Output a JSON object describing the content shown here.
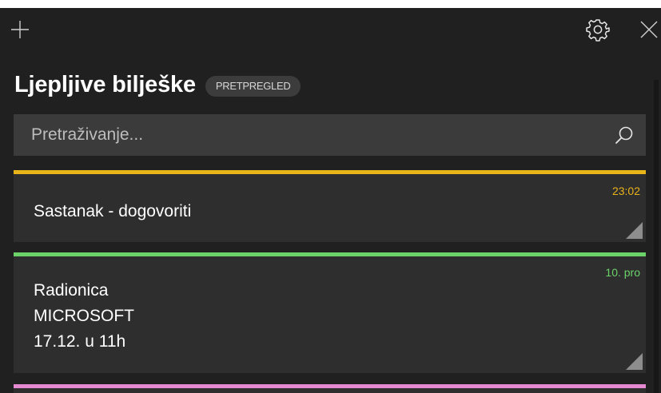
{
  "app": {
    "title": "Ljepljive bilješke",
    "badge": "PRETPREGLED"
  },
  "toolbar": {
    "new_note_icon": "plus-icon",
    "settings_icon": "gear-icon",
    "close_icon": "close-icon"
  },
  "search": {
    "placeholder": "Pretraživanje...",
    "value": "",
    "icon": "search-icon"
  },
  "colors": {
    "background": "#202020",
    "note_background": "#2e2e2e",
    "search_background": "#3b3b3b",
    "note_yellow": "#e9b31a",
    "note_green": "#6bd36a",
    "note_pink": "#e58ad0"
  },
  "notes": [
    {
      "color": "#e9b31a",
      "time": "23:02",
      "lines": [
        "Sastanak - dogovoriti"
      ]
    },
    {
      "color": "#6bd36a",
      "time": "10. pro",
      "lines": [
        "Radionica",
        "MICROSOFT",
        "17.12. u 11h"
      ]
    },
    {
      "color": "#e58ad0",
      "time": "",
      "lines": []
    }
  ]
}
